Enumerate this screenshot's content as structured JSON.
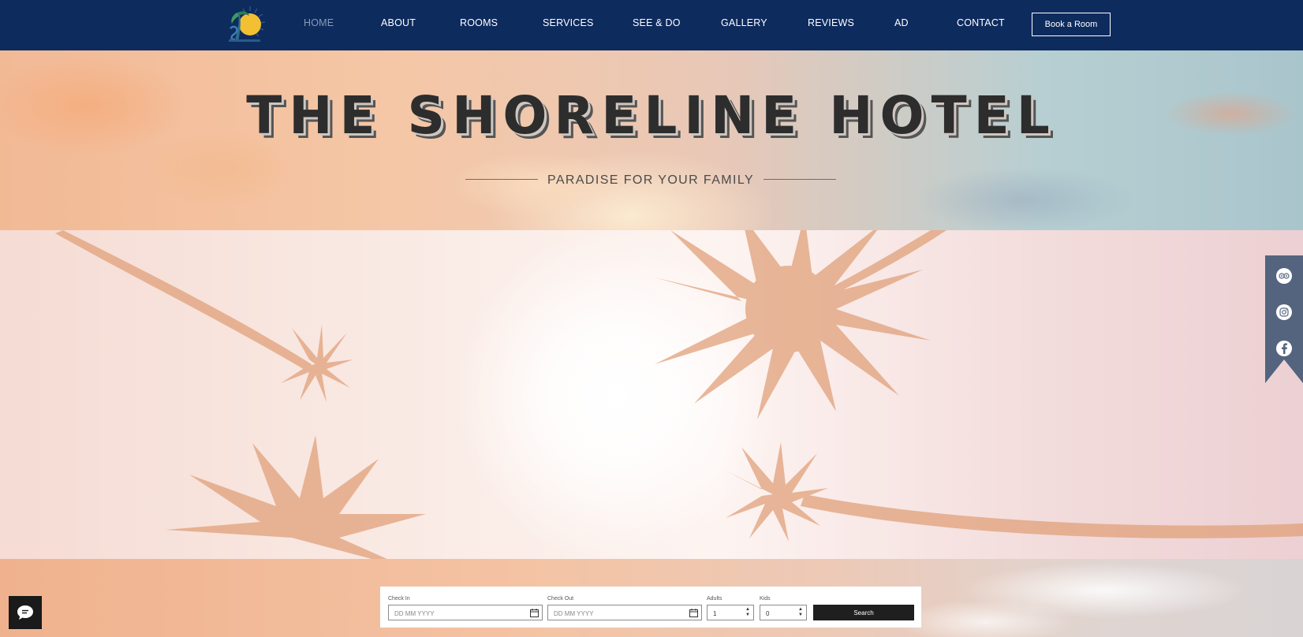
{
  "nav": {
    "items": [
      {
        "label": "HOME",
        "active": true
      },
      {
        "label": "ABOUT"
      },
      {
        "label": "ROOMS"
      },
      {
        "label": "SERVICES"
      },
      {
        "label": "SEE & DO"
      },
      {
        "label": "GALLERY"
      },
      {
        "label": "REVIEWS"
      },
      {
        "label": "AD"
      },
      {
        "label": "CONTACT"
      }
    ],
    "cta_label": "Book a Room",
    "background_color": "#0e2b5e"
  },
  "hero": {
    "title": "THE SHORELINE HOTEL",
    "tagline": "PARADISE FOR YOUR FAMILY"
  },
  "social": {
    "icons": [
      "tripadvisor-icon",
      "instagram-icon",
      "facebook-icon"
    ]
  },
  "booking": {
    "check_in": {
      "label": "Check In",
      "placeholder": "DD MM YYYY"
    },
    "check_out": {
      "label": "Check Out",
      "placeholder": "DD MM YYYY"
    },
    "adults": {
      "label": "Adults",
      "value": "1"
    },
    "kids": {
      "label": "Kids",
      "value": "0"
    },
    "search_label": "Search"
  },
  "chat": {
    "icon": "chat-icon"
  }
}
